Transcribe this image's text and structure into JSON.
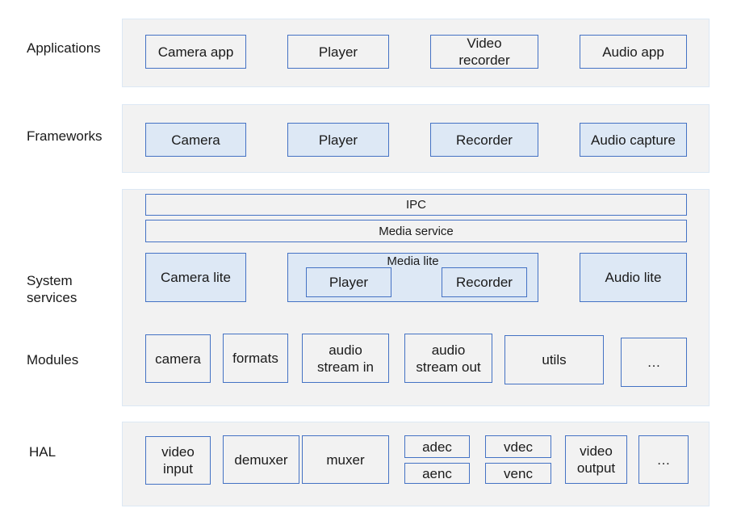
{
  "layers": {
    "applications": "Applications",
    "frameworks": "Frameworks",
    "system_services": "System\nservices",
    "modules": "Modules",
    "hal": "HAL"
  },
  "applications": [
    "Camera app",
    "Player",
    "Video\nrecorder",
    "Audio app"
  ],
  "frameworks": [
    "Camera",
    "Player",
    "Recorder",
    "Audio capture"
  ],
  "system_services": {
    "ipc": "IPC",
    "media_service": "Media service",
    "camera_lite": "Camera lite",
    "media_lite": {
      "title": "Media lite",
      "player": "Player",
      "recorder": "Recorder"
    },
    "audio_lite": "Audio lite"
  },
  "modules": [
    "camera",
    "formats",
    "audio\nstream in",
    "audio\nstream out",
    "utils",
    "…"
  ],
  "hal": {
    "video_input": "video\ninput",
    "demuxer": "demuxer",
    "muxer": "muxer",
    "adec": "adec",
    "aenc": "aenc",
    "vdec": "vdec",
    "venc": "venc",
    "video_output": "video\noutput",
    "more": "…"
  },
  "colors": {
    "border": "#4472c4",
    "panel": "#f2f2f2",
    "highlight": "#dde8f5"
  }
}
